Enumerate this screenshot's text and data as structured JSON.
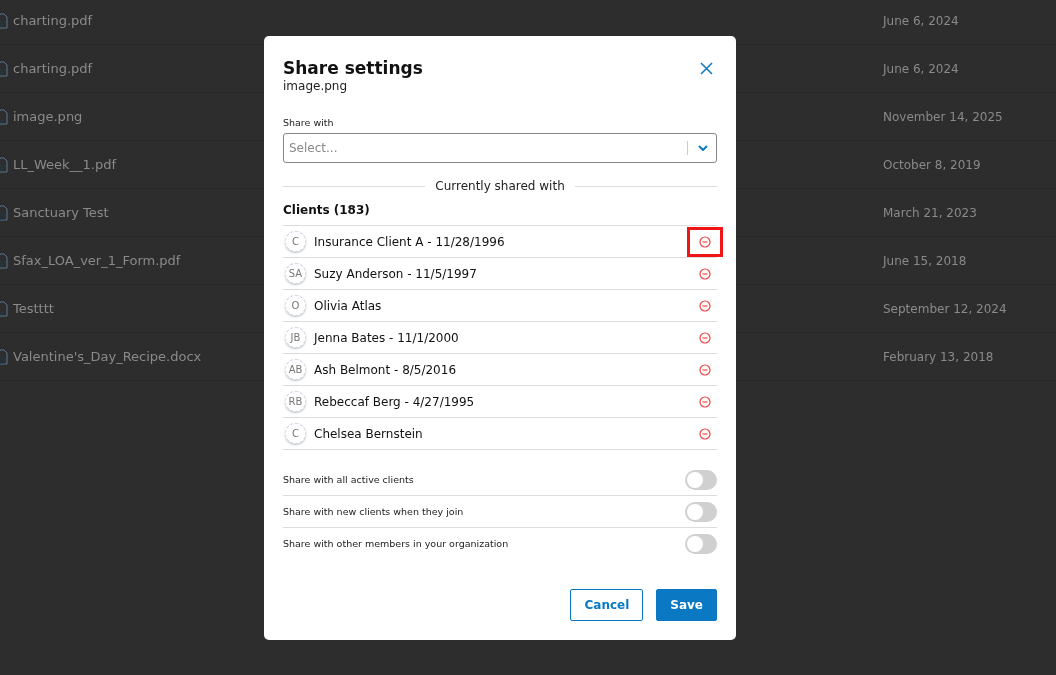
{
  "files": [
    {
      "name": "charting.pdf",
      "kind": "pdf",
      "date": "June 6, 2024"
    },
    {
      "name": "charting.pdf",
      "kind": "pdf",
      "date": "June 6, 2024"
    },
    {
      "name": "image.png",
      "kind": "image",
      "date": "November 14, 2025"
    },
    {
      "name": "LL_Week__1.pdf",
      "kind": "pdf",
      "date": "October 8, 2019"
    },
    {
      "name": "Sanctuary Test",
      "kind": "doc",
      "date": "March 21, 2023"
    },
    {
      "name": "Sfax_LOA_ver_1_Form.pdf",
      "kind": "pdf",
      "date": "June 15, 2018"
    },
    {
      "name": "Testttt",
      "kind": "image",
      "date": "September 12, 2024"
    },
    {
      "name": "Valentine's_Day_Recipe.docx",
      "kind": "doc",
      "date": "February 13, 2018"
    }
  ],
  "dialog": {
    "title": "Share settings",
    "subtitle": "image.png",
    "share_with": {
      "label": "Share with",
      "placeholder": "Select..."
    },
    "divider": "Currently shared with",
    "clients_heading": "Clients (183)",
    "clients": [
      {
        "initials": "C",
        "name": "Insurance Client A - 11/28/1996",
        "highlighted": true
      },
      {
        "initials": "SA",
        "name": "Suzy Anderson - 11/5/1997",
        "highlighted": false
      },
      {
        "initials": "O",
        "name": "Olivia Atlas",
        "highlighted": false
      },
      {
        "initials": "JB",
        "name": "Jenna Bates - 11/1/2000",
        "highlighted": false
      },
      {
        "initials": "AB",
        "name": "Ash Belmont - 8/5/2016",
        "highlighted": false
      },
      {
        "initials": "RB",
        "name": "Rebeccaf Berg - 4/27/1995",
        "highlighted": false
      },
      {
        "initials": "C",
        "name": "Chelsea Bernstein",
        "highlighted": false
      }
    ],
    "toggles": [
      {
        "label": "Share with all active clients",
        "on": false
      },
      {
        "label": "Share with new clients when they join",
        "on": false
      },
      {
        "label": "Share with other members in your organization",
        "on": false
      }
    ],
    "buttons": [
      {
        "label": "Cancel",
        "kind": "secondary"
      },
      {
        "label": "Save",
        "kind": "primary"
      }
    ]
  }
}
